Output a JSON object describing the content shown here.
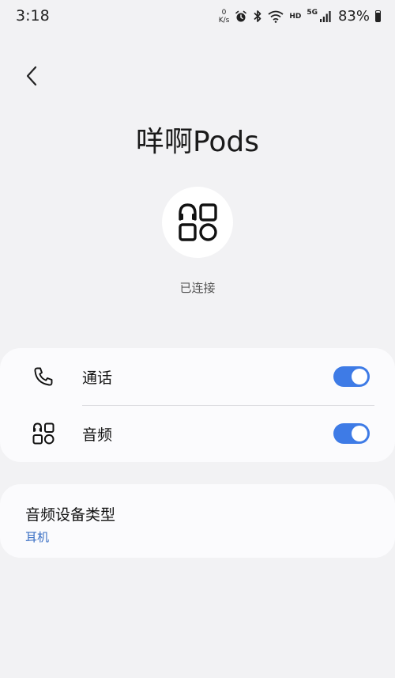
{
  "status_bar": {
    "time": "3:18",
    "net_speed_value": "0",
    "net_speed_unit": "K/s",
    "hd_label": "HD",
    "network_label": "5G",
    "battery_percent": "83%",
    "icons": [
      "alarm-icon",
      "bluetooth-icon",
      "wifi-icon",
      "signal-icon",
      "battery-icon"
    ]
  },
  "header": {
    "back_icon": "chevron-left-icon",
    "device_name": "咩啊Pods",
    "device_icon": "earbuds-apps-icon",
    "connection_status": "已连接"
  },
  "profiles": [
    {
      "icon": "phone-icon",
      "label": "通话",
      "enabled": true
    },
    {
      "icon": "audio-grid-icon",
      "label": "音频",
      "enabled": true
    }
  ],
  "device_type": {
    "title": "音频设备类型",
    "value": "耳机"
  },
  "colors": {
    "background": "#f2f2f4",
    "card": "#fbfbfd",
    "accent": "#3e7be6",
    "link": "#3a6fc4"
  }
}
